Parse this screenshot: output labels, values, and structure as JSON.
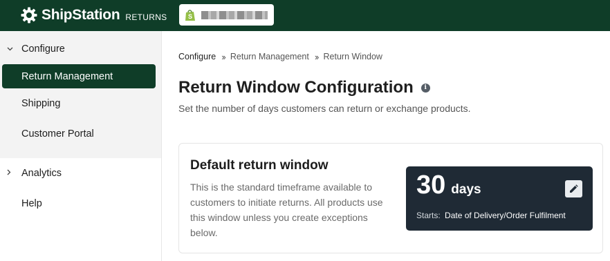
{
  "header": {
    "brand_name": "ShipStation",
    "brand_sub": "RETURNS",
    "store_icon": "shopify-bag-icon"
  },
  "sidebar": {
    "items": [
      {
        "label": "Configure",
        "icon": "chevron-down-icon"
      },
      {
        "label": "Return Management",
        "active": true
      },
      {
        "label": "Shipping"
      },
      {
        "label": "Customer Portal"
      },
      {
        "label": "Analytics",
        "icon": "chevron-right-icon"
      },
      {
        "label": "Help"
      }
    ]
  },
  "breadcrumb": [
    "Configure",
    "Return Management",
    "Return Window"
  ],
  "page": {
    "title": "Return Window Configuration",
    "subtitle": "Set the number of days customers can return or exchange products."
  },
  "card": {
    "title": "Default return window",
    "description": "This is the standard timeframe available to customers to initiate returns. All products use this window unless you create exceptions below.",
    "window": {
      "days": "30",
      "unit": "days",
      "starts_label": "Starts:",
      "starts_value": "Date of Delivery/Order Fulfilment"
    }
  },
  "colors": {
    "topbar": "#0f3d28",
    "active_nav": "#0f3d28",
    "window_box": "#1f2a35",
    "shopify_green": "#95bf47"
  }
}
